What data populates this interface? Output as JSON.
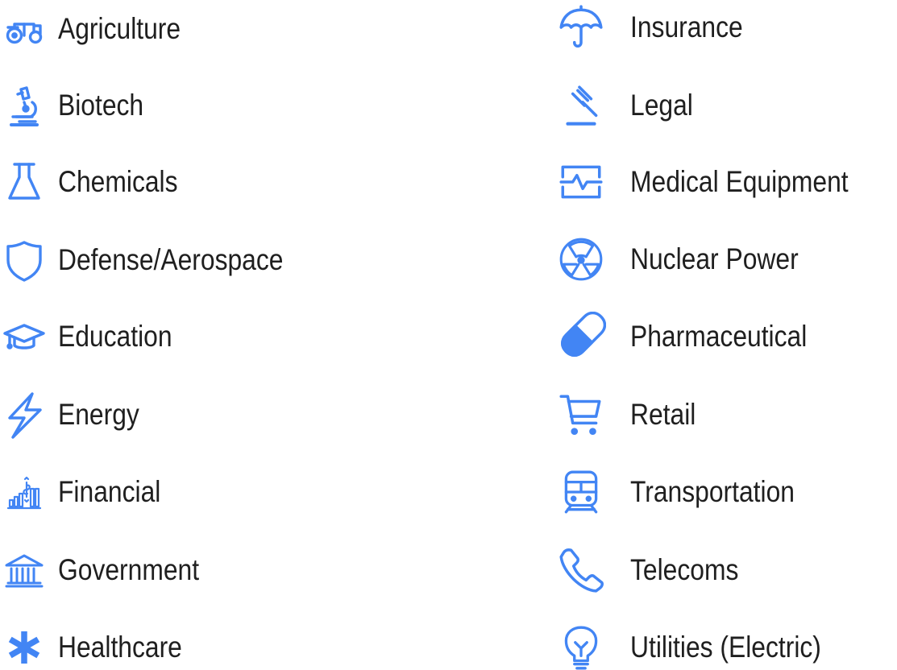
{
  "accent_color": "#4285f4",
  "left_items": [
    {
      "label": "Agriculture",
      "icon": "tractor-icon"
    },
    {
      "label": "Biotech",
      "icon": "microscope-icon"
    },
    {
      "label": "Chemicals",
      "icon": "flask-icon"
    },
    {
      "label": "Defense/Aerospace",
      "icon": "shield-icon"
    },
    {
      "label": "Education",
      "icon": "graduation-cap-icon"
    },
    {
      "label": "Energy",
      "icon": "lightning-bolt-icon"
    },
    {
      "label": "Financial",
      "icon": "finance-chart-icon"
    },
    {
      "label": "Government",
      "icon": "bank-building-icon"
    },
    {
      "label": "Healthcare",
      "icon": "asterisk-icon"
    }
  ],
  "right_items": [
    {
      "label": "Insurance",
      "icon": "umbrella-icon"
    },
    {
      "label": "Legal",
      "icon": "gavel-icon"
    },
    {
      "label": "Medical Equipment",
      "icon": "heart-monitor-icon"
    },
    {
      "label": "Nuclear Power",
      "icon": "radioactive-icon"
    },
    {
      "label": "Pharmaceutical",
      "icon": "pill-icon"
    },
    {
      "label": "Retail",
      "icon": "shopping-cart-icon"
    },
    {
      "label": "Transportation",
      "icon": "train-icon"
    },
    {
      "label": "Telecoms",
      "icon": "phone-icon"
    },
    {
      "label": "Utilities (Electric)",
      "icon": "lightbulb-icon"
    }
  ]
}
